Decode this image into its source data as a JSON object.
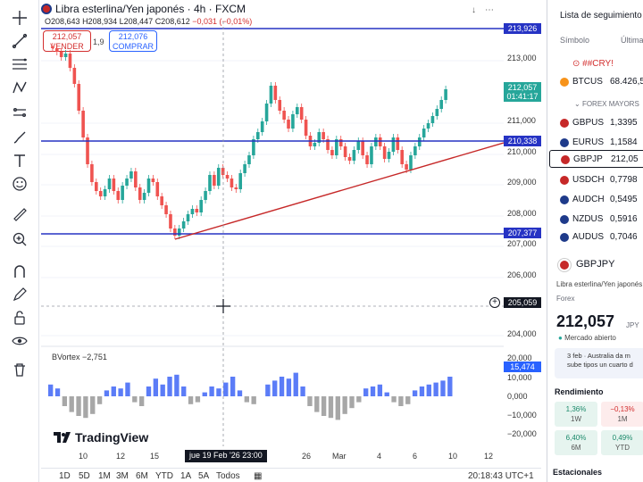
{
  "symbol_bar": {
    "title": "Libra esterlina/Yen japonés · 4h · FXCM",
    "ohlc_o": "O208,643",
    "ohlc_h": "H208,934",
    "ohlc_l": "L208,447",
    "ohlc_c": "C208,612",
    "ohlc_change": "−0,031 (−0,01%)"
  },
  "trade": {
    "sell_price": "212,057",
    "sell_label": "VENDER",
    "spread": "1,9",
    "buy_price": "212,076",
    "buy_label": "COMPRAR"
  },
  "price_axis": {
    "labels": [
      "213,000",
      "211,000",
      "210,000",
      "209,000",
      "208,000",
      "207,000",
      "206,000",
      "204,000"
    ],
    "hline_upper": "213,926",
    "current_price": "212,057",
    "countdown": "01:41:17",
    "hline_mid": "210,338",
    "hline_lower": "207,377",
    "crosshair_price": "205,059"
  },
  "indicator": {
    "name": "BVortex",
    "value": "−2,751",
    "axis_labels": [
      "20,000",
      "10,000",
      "0,000",
      "−10,000",
      "−20,000"
    ],
    "current": "15,474"
  },
  "time_axis": {
    "labels": [
      "10",
      "12",
      "15",
      "26",
      "Mar",
      "4",
      "6",
      "10",
      "12"
    ],
    "crosshair_date": "jue 19 Feb '26   23:00"
  },
  "branding": {
    "logo_text": "TradingView"
  },
  "bottom_bar": {
    "ranges": [
      "1D",
      "5D",
      "1M",
      "3M",
      "6M",
      "YTD",
      "1A",
      "5A",
      "Todos"
    ],
    "clock": "20:18:43 UTC+1"
  },
  "watchlist": {
    "title": "Lista de seguimiento",
    "col_symbol": "Símbolo",
    "col_last": "Última",
    "crypto_section": "##CRY!",
    "rows": [
      {
        "symbol": "BTCUS",
        "price": "68.426,5",
        "color": "#f7931a"
      },
      {
        "symbol": "GBPUS",
        "price": "1,3395",
        "color": "#c62828"
      },
      {
        "symbol": "EURUS",
        "price": "1,1584",
        "color": "#1e3a8a"
      },
      {
        "symbol": "GBPJP",
        "price": "212,05",
        "color": "#c62828"
      },
      {
        "symbol": "USDCH",
        "price": "0,7798",
        "color": "#c62828"
      },
      {
        "symbol": "AUDCH",
        "price": "0,5495",
        "color": "#1e3a8a"
      },
      {
        "symbol": "NZDUS",
        "price": "0,5916",
        "color": "#1e3a8a"
      },
      {
        "symbol": "AUDUS",
        "price": "0,7046",
        "color": "#1e3a8a"
      }
    ],
    "forex_section": "FOREX MAYORS"
  },
  "detail": {
    "symbol": "GBPJPY",
    "name": "Libra esterlina/Yen japonés",
    "type": "Forex",
    "price": "212,057",
    "currency": "JPY",
    "status": "Mercado abierto",
    "news_line1": "3 feb · Australia da m",
    "news_line2": "sube tipos un cuarto d",
    "performance_title": "Rendimiento",
    "perf": [
      {
        "value": "1,36%",
        "period": "1W",
        "positive": true
      },
      {
        "value": "−0,13%",
        "period": "1M",
        "positive": false
      },
      {
        "value": "6,40%",
        "period": "6M",
        "positive": true
      },
      {
        "value": "0,49%",
        "period": "YTD",
        "positive": true
      }
    ],
    "stats_title": "Estacionales"
  },
  "colors": {
    "up": "#26a69a",
    "down": "#ef5350",
    "hline": "#2633c4",
    "trendline": "#c62828",
    "accent": "#2962ff"
  }
}
